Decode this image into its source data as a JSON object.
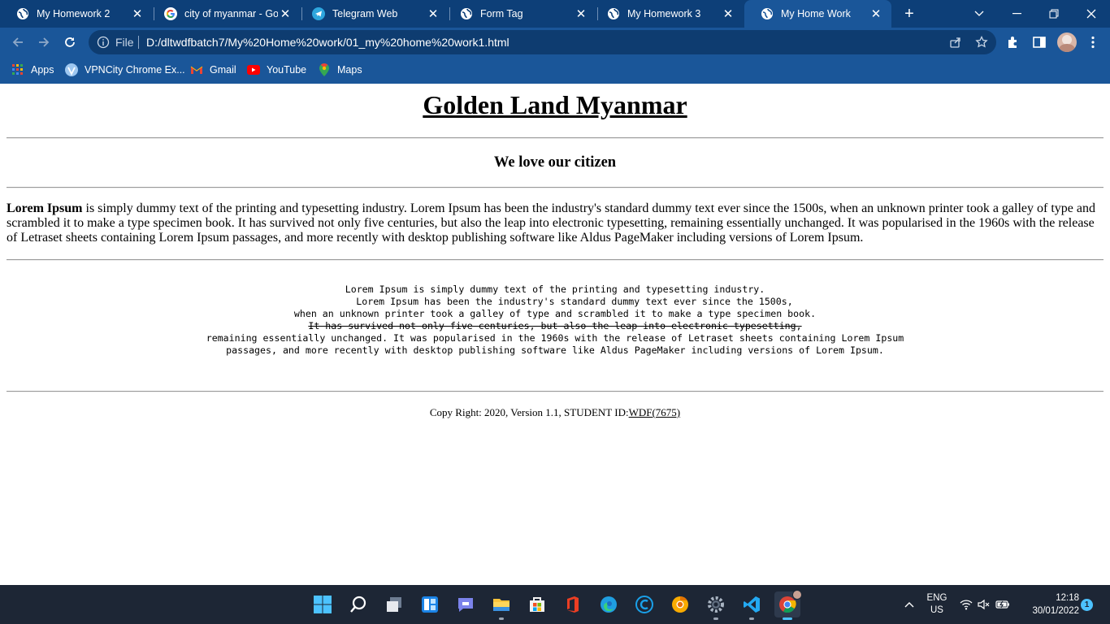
{
  "browser": {
    "tabs": [
      {
        "title": "My Homework 2",
        "icon": "globe-icon",
        "active": false
      },
      {
        "title": "city of myanmar - Goo",
        "icon": "google-icon",
        "active": false
      },
      {
        "title": "Telegram Web",
        "icon": "telegram-icon",
        "active": false
      },
      {
        "title": "Form Tag",
        "icon": "globe-icon",
        "active": false
      },
      {
        "title": "My Homework 3",
        "icon": "globe-icon",
        "active": false
      },
      {
        "title": "My Home Work",
        "icon": "globe-icon",
        "active": true
      }
    ],
    "close_glyph": "✕",
    "new_tab_glyph": "+",
    "address": {
      "scheme_label": "File",
      "url": "D:/dltwdfbatch7/My%20Home%20work/01_my%20home%20work1.html"
    },
    "bookmarks": [
      {
        "label": "Apps",
        "icon": "apps-grid-icon"
      },
      {
        "label": "VPNCity Chrome Ex...",
        "icon": "vpncity-icon"
      },
      {
        "label": "Gmail",
        "icon": "gmail-icon"
      },
      {
        "label": "YouTube",
        "icon": "youtube-icon"
      },
      {
        "label": "Maps",
        "icon": "maps-icon"
      }
    ],
    "colors": {
      "tabstrip": "#0d3f78",
      "toolbar": "#1a5699",
      "omnibox": "#0e3c70"
    }
  },
  "page": {
    "heading": "Golden Land Myanmar",
    "subheading": "We love our citizen",
    "paragraph_bold": "Lorem Ipsum",
    "paragraph_rest": " is simply dummy text of the printing and typesetting industry. Lorem Ipsum has been the industry's standard dummy text ever since the 1500s, when an unknown printer took a galley of type and scrambled it to make a type specimen book. It has survived not only five centuries, but also the leap into electronic typesetting, remaining essentially unchanged. It was popularised in the 1960s with the release of Letraset sheets containing Lorem Ipsum passages, and more recently with desktop publishing software like Aldus PageMaker including versions of Lorem Ipsum.",
    "pre_lines": [
      "Lorem Ipsum is simply dummy text of the printing and typesetting industry.",
      "Lorem Ipsum has been the industry's standard dummy text ever since the 1500s,",
      "when an unknown printer took a galley of type and scrambled it to make a type specimen book.",
      "It has survived not only five centuries, but also the leap into electronic typesetting,",
      "remaining essentially unchanged. It was popularised in the 1960s with the release of Letraset sheets containing Lorem Ipsum",
      "passages, and more recently with desktop publishing software like Aldus PageMaker including versions of Lorem Ipsum."
    ],
    "footer_text": "Copy Right: 2020, Version 1.1, STUDENT ID:",
    "footer_link": "WDF(7675)"
  },
  "taskbar": {
    "apps": [
      "windows-start-icon",
      "search-icon",
      "task-view-icon",
      "widgets-icon",
      "teams-chat-icon",
      "file-explorer-icon",
      "microsoft-store-icon",
      "office-icon",
      "edge-icon",
      "ccleaner-icon",
      "chrome-canary-icon",
      "settings-icon",
      "vscode-icon",
      "chrome-icon"
    ],
    "language": "ENG",
    "region": "US",
    "time": "12:18",
    "date": "30/01/2022",
    "notification_count": "1"
  }
}
